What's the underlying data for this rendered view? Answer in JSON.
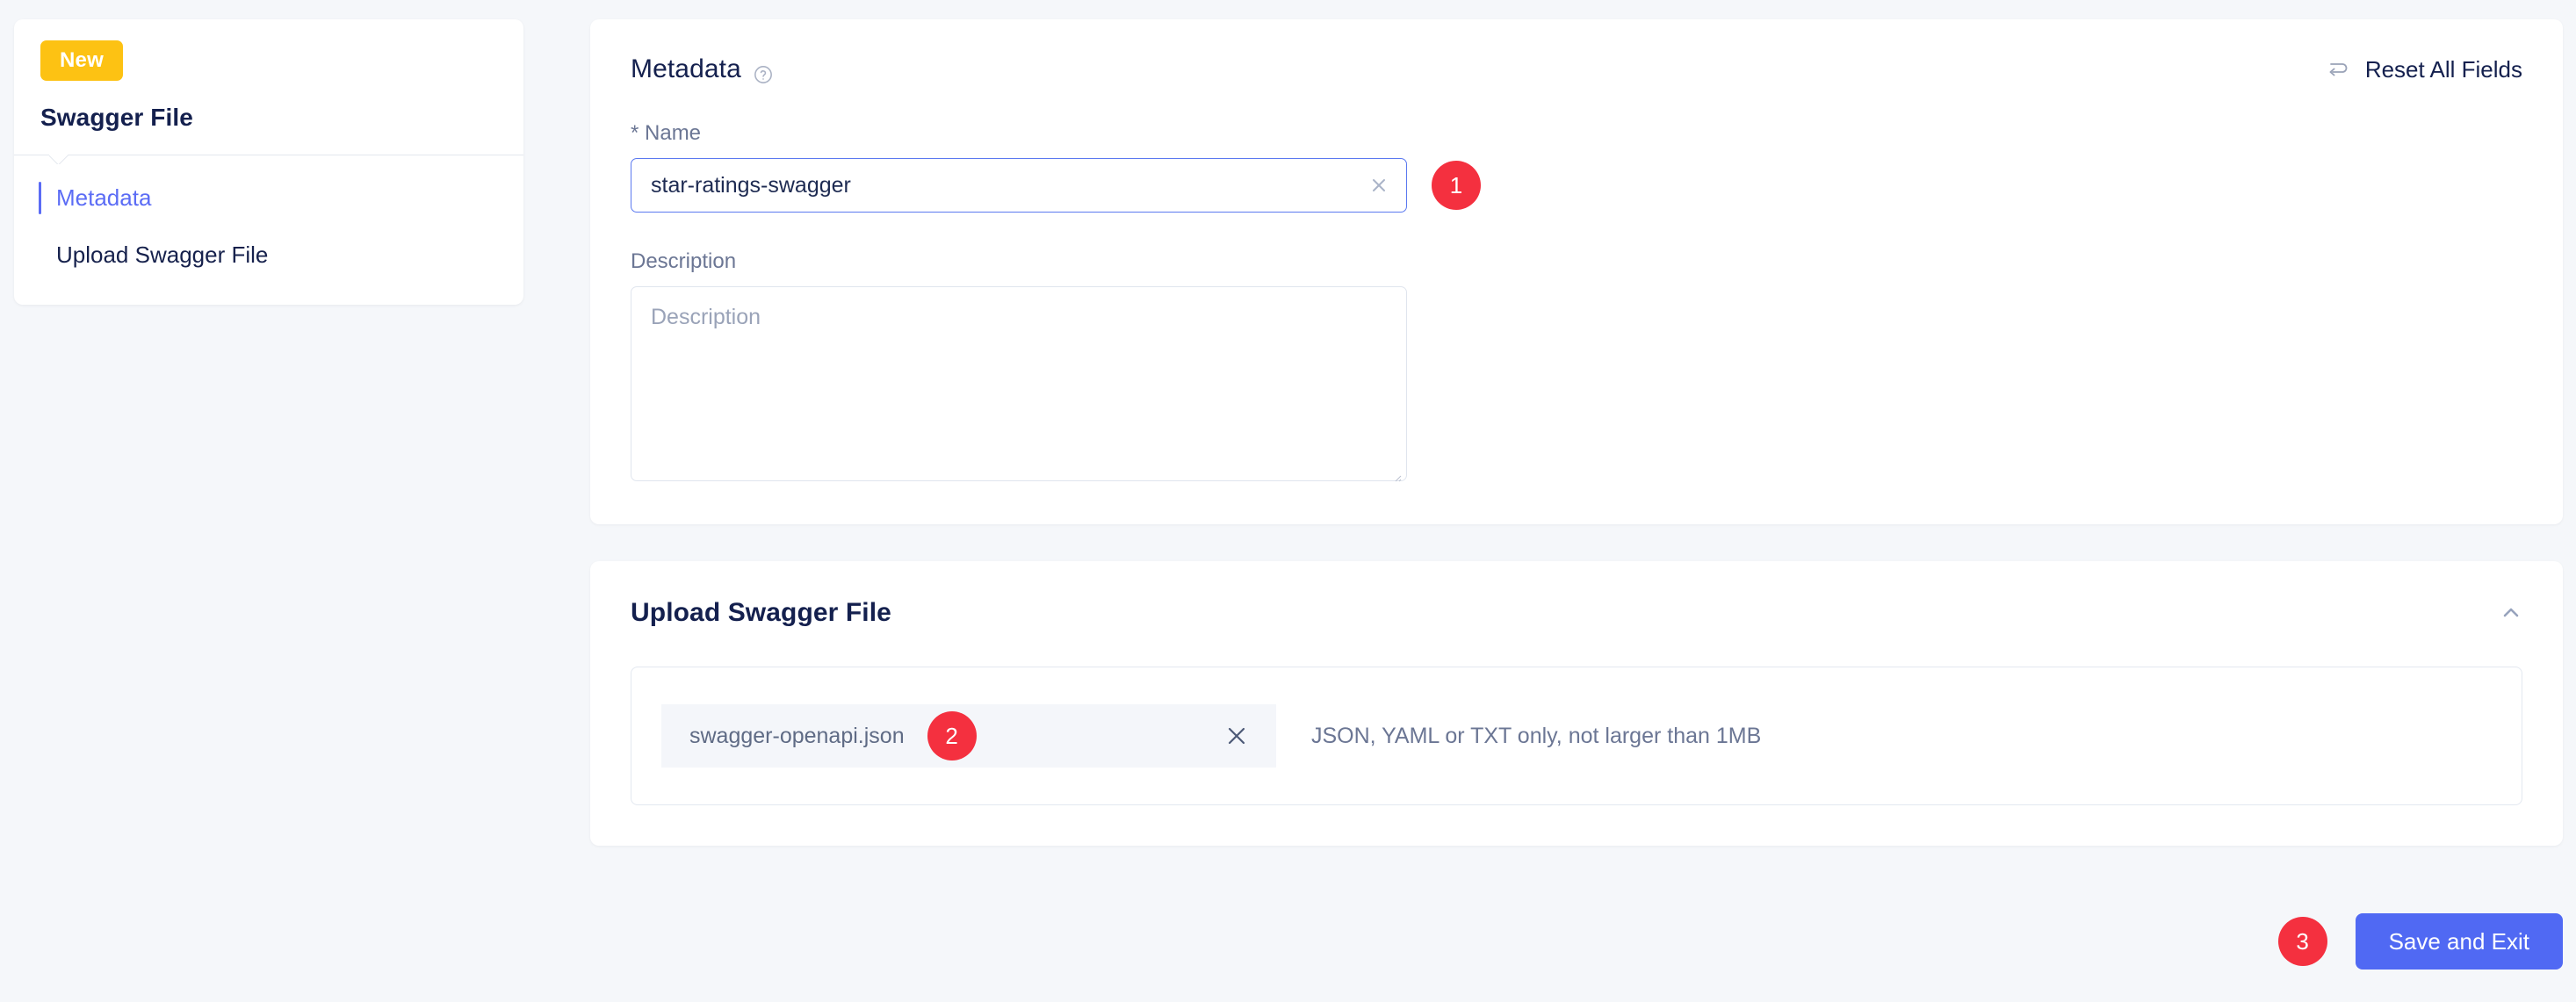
{
  "sidebar": {
    "status_badge": "New",
    "title": "Swagger File",
    "items": [
      {
        "label": "Metadata",
        "active": true
      },
      {
        "label": "Upload Swagger File",
        "active": false
      }
    ]
  },
  "metadata_card": {
    "title": "Metadata",
    "help_icon": "help-circle-icon",
    "reset": {
      "label": "Reset All Fields",
      "icon": "undo-arrow-icon"
    },
    "name_field": {
      "label": "* Name",
      "value": "star-ratings-swagger",
      "placeholder": "Name",
      "clear_icon": "close-icon",
      "step_badge": "1"
    },
    "description_field": {
      "label": "Description",
      "value": "",
      "placeholder": "Description"
    }
  },
  "upload_card": {
    "title": "Upload Swagger File",
    "collapse_icon": "chevron-up-icon",
    "file": {
      "name": "swagger-openapi.json",
      "step_badge": "2",
      "remove_icon": "close-icon"
    },
    "hint": "JSON, YAML or TXT only, not larger than 1MB"
  },
  "footer": {
    "step_badge": "3",
    "save_label": "Save and Exit"
  },
  "colors": {
    "accent_blue": "#5069f3",
    "badge_red": "#f4303f",
    "new_yellow": "#fdc213",
    "title_navy": "#14204e",
    "page_bg": "#f5f7fa"
  }
}
